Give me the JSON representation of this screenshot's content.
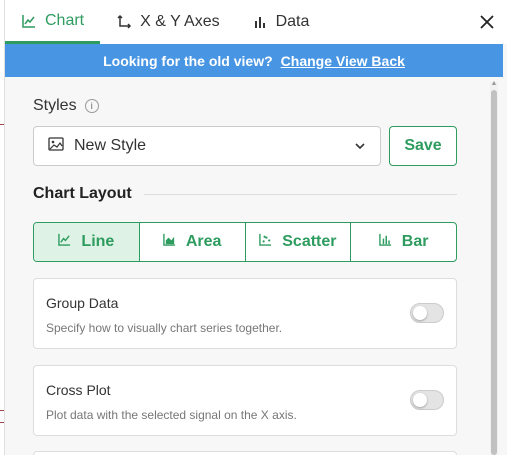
{
  "tabs": [
    {
      "label": "Chart",
      "icon": "line-chart-icon",
      "active": true
    },
    {
      "label": "X & Y Axes",
      "icon": "axes-icon",
      "active": false
    },
    {
      "label": "Data",
      "icon": "bar-chart-icon",
      "active": false
    }
  ],
  "banner": {
    "text": "Looking for the old view?",
    "link": "Change View Back"
  },
  "styles": {
    "label": "Styles",
    "selected": "New Style",
    "save_label": "Save"
  },
  "chart_layout": {
    "heading": "Chart Layout",
    "options": [
      {
        "label": "Line",
        "icon": "line-chart-icon",
        "active": true
      },
      {
        "label": "Area",
        "icon": "area-chart-icon",
        "active": false
      },
      {
        "label": "Scatter",
        "icon": "scatter-chart-icon",
        "active": false
      },
      {
        "label": "Bar",
        "icon": "bar-chart-icon",
        "active": false
      }
    ]
  },
  "group_data": {
    "title": "Group Data",
    "description": "Specify how to visually chart series together.",
    "enabled": false
  },
  "cross_plot": {
    "title": "Cross Plot",
    "description": "Plot data with the selected signal on the X axis.",
    "enabled": false
  },
  "colors": {
    "accent": "#2e9c5f",
    "banner": "#4896e3",
    "active_segment": "#dff2e6"
  }
}
